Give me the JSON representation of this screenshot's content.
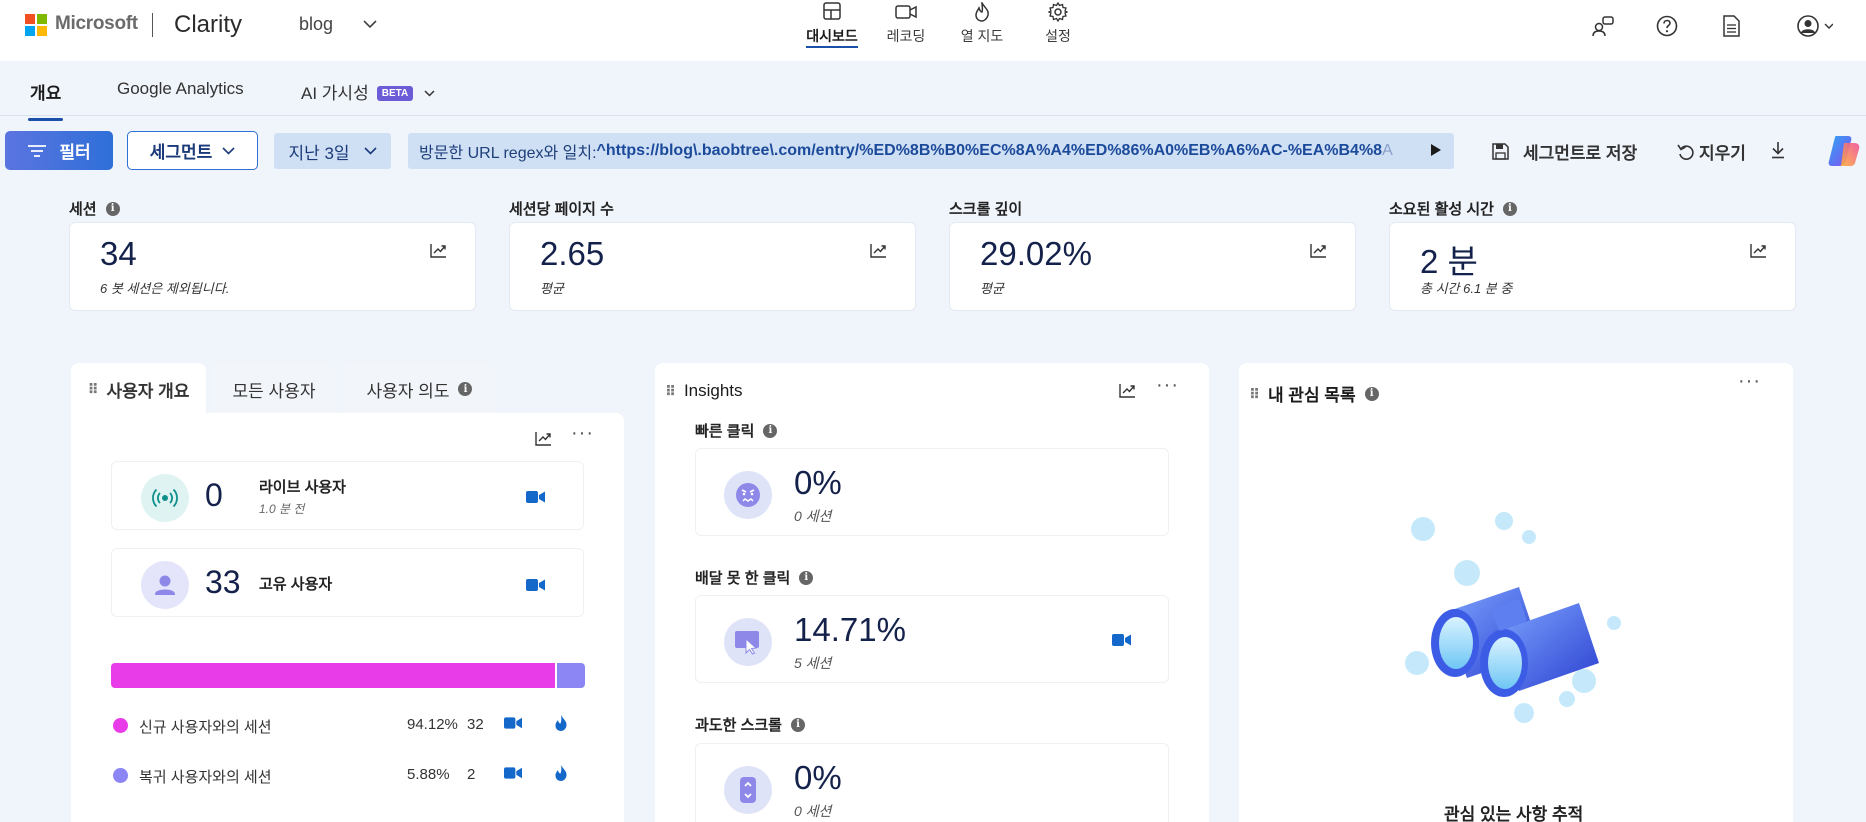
{
  "header": {
    "brand": "Microsoft",
    "product": "Clarity",
    "project": "blog",
    "nav": [
      {
        "label": "대시보드",
        "icon": "dashboard-icon",
        "active": true
      },
      {
        "label": "레코딩",
        "icon": "video-icon",
        "active": false
      },
      {
        "label": "열 지도",
        "icon": "flame-icon",
        "active": false
      },
      {
        "label": "설정",
        "icon": "gear-icon",
        "active": false
      }
    ]
  },
  "subtabs": {
    "overview": "개요",
    "google_analytics": "Google Analytics",
    "ai_visibility": "AI 가시성",
    "beta": "BETA"
  },
  "filterbar": {
    "filter_label": "필터",
    "segment_label": "세그먼트",
    "date_label": "지난 3일",
    "url_prefix": "방문한 URL regex와 일치: ",
    "url_value": "^https://blog\\.baobtree\\.com/entry/%ED%8B%B0%EC%8A%A4%ED%86%A0%EB%A6%AC-%EA%B4%8",
    "url_suffix": "A",
    "save_segment_label": "세그먼트로 저장",
    "clear_label": "지우기"
  },
  "metrics": [
    {
      "label": "세션",
      "value": "34",
      "sub": "6 봇 세션은 제외됩니다.",
      "has_info": true
    },
    {
      "label": "세션당 페이지 수",
      "value": "2.65",
      "sub": "평균",
      "has_info": false
    },
    {
      "label": "스크롤 깊이",
      "value": "29.02%",
      "sub": "평균",
      "has_info": false
    },
    {
      "label": "소요된 활성 시간",
      "value": "2 분",
      "sub": "총 시간 6.1 분 중",
      "has_info": true
    }
  ],
  "users_panel": {
    "tabs": [
      "사용자 개요",
      "모든 사용자",
      "사용자 의도"
    ],
    "live_users": {
      "value": "0",
      "label": "라이브 사용자",
      "sub": "1.0 분 전"
    },
    "unique_users": {
      "value": "33",
      "label": "고유 사용자"
    },
    "split": {
      "new_fraction": 0.9412,
      "returning_fraction": 0.0588
    },
    "legend": [
      {
        "name": "신규 사용자와의 세션",
        "pct": "94.12%",
        "count": "32",
        "color": "#e83ce8"
      },
      {
        "name": "복귀 사용자와의 세션",
        "pct": "5.88%",
        "count": "2",
        "color": "#8b86f3"
      }
    ]
  },
  "insights": {
    "title": "Insights",
    "items": [
      {
        "label": "빠른 클릭",
        "value": "0%",
        "sessions": "0 세션",
        "icon": "angry-face-icon",
        "video": false
      },
      {
        "label": "배달 못 한 클릭",
        "value": "14.71%",
        "sessions": "5 세션",
        "icon": "dead-click-icon",
        "video": true
      },
      {
        "label": "과도한 스크롤",
        "value": "0%",
        "sessions": "0 세션",
        "icon": "scroll-icon",
        "video": false
      }
    ]
  },
  "watchlist": {
    "title": "내 관심 목록",
    "caption": "관심 있는 사항 추적"
  },
  "colors": {
    "accent": "#2f6fd8",
    "navy_value": "#14214a",
    "new_users": "#e83ce8",
    "returning_users": "#8b86f3",
    "video_icon": "#1468c9"
  }
}
